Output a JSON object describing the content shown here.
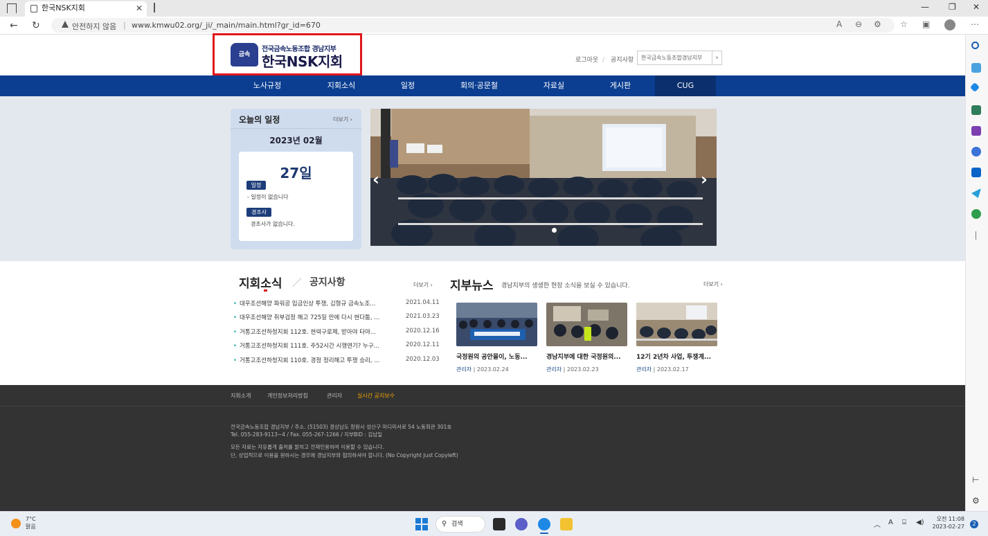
{
  "browser": {
    "tab_title": "한국NSK지회",
    "security_label": "안전하지 않음",
    "url": "www.kmwu02.org/_ji/_main/main.html?gr_id=670"
  },
  "header": {
    "logo_sub": "전국금속노동조합 경남지부",
    "logo_main": "한국NSK지회",
    "emblem_text": "금속",
    "links": [
      "로그아웃",
      "공지사항"
    ],
    "select_label": "한국금속노동조합경남지부"
  },
  "nav": {
    "items": [
      "노사규정",
      "지회소식",
      "일정",
      "회의·공문철",
      "자료실",
      "게시판"
    ],
    "cug": "CUG"
  },
  "schedule": {
    "title": "오늘의 일정",
    "more": "더보기",
    "month": "2023년 02월",
    "day": "27일",
    "badge1": "일정",
    "text1": "- 일정이 없습니다",
    "badge2": "경조사",
    "text2": "경조사가 없습니다."
  },
  "news": {
    "title": "지회소식",
    "tab2": "공지사항",
    "more": "더보기",
    "items": [
      {
        "title": "대우조선해양 파워공 입금인상 투쟁, 김형규 금속노조...",
        "date": "2021.04.11"
      },
      {
        "title": "대우조선해양 취부검정 해고 725일 만에 다시 현다툼, ...",
        "date": "2021.03.23"
      },
      {
        "title": "거통고조선하청지회 112호. 현력구로제, 받아야 타야...",
        "date": "2020.12.16"
      },
      {
        "title": "거통고조선하청지회 111호. 주52시간 시행연기? 누구...",
        "date": "2020.12.11"
      },
      {
        "title": "거통고조선하청지회 110호. 경정 정리해고 투쟁 승리, ...",
        "date": "2020.12.03"
      }
    ]
  },
  "branch": {
    "title": "지부뉴스",
    "subtitle": "경남지부의 생생한 현장 소식을 보실 수 있습니다.",
    "more": "더보기",
    "cards": [
      {
        "title": "국정원의 공안몰이, 노동...",
        "author": "관리자",
        "date": "2023.02.24"
      },
      {
        "title": "경남지부에 대한 국정원의...",
        "author": "관리자",
        "date": "2023.02.23"
      },
      {
        "title": "12기 2년차 사업, 투쟁계...",
        "author": "관리자",
        "date": "2023.02.17"
      }
    ]
  },
  "footer": {
    "links": [
      "지회소개",
      "개인정보처리방침",
      "관리자"
    ],
    "highlight_link": "실시간 공지보수",
    "lines": [
      "전국금속노동조합 경남지부 / 주소. (51503) 경상남도 창원시 성산구 마디미서로 54 노동회관 301호",
      "Tel. 055-283-9113~4 / Fax. 055-267-1266 / 지부BID : 김남일",
      "모든 자료는 자유롭게 출처를 밝히고 전재인용하여 이용할 수 있습니다.",
      "단, 상업적으로 이용을 원하시는 경우에 경남지부와 협의하셔야 합니다. (No Copyright Just Copyleft)"
    ]
  },
  "taskbar": {
    "temp": "7°C",
    "weather": "맑음",
    "search": "검색",
    "time": "오전 11:08",
    "date": "2023-02-27",
    "notif_count": "2"
  }
}
